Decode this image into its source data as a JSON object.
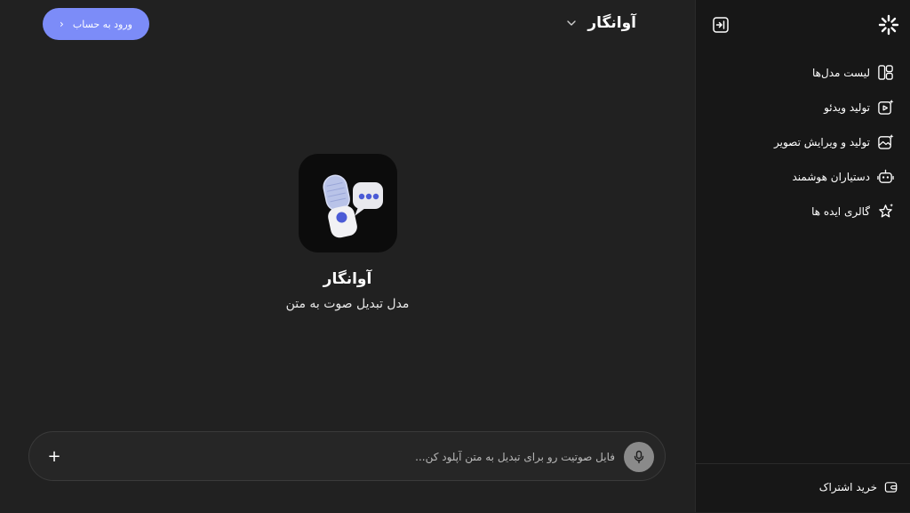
{
  "header": {
    "login_label": "ورود به حساب",
    "model_name": "آوانگار"
  },
  "hero": {
    "title": "آوانگار",
    "subtitle": "مدل تبدیل صوت به متن"
  },
  "composer": {
    "placeholder": "فایل صوتیت رو برای تبدیل به متن آپلود کن...",
    "value": "",
    "plus_label": "+"
  },
  "sidebar": {
    "items": [
      {
        "label": "لیست مدل‌ها",
        "icon": "layout-grid-icon"
      },
      {
        "label": "تولید ویدئو",
        "icon": "video-sparkle-icon"
      },
      {
        "label": "تولید و ویرایش تصویر",
        "icon": "image-sparkle-icon"
      },
      {
        "label": "دستیاران هوشمند",
        "icon": "robot-icon"
      },
      {
        "label": "گالری ایده ها",
        "icon": "star-sparkle-icon"
      }
    ],
    "footer": {
      "buy_label": "خرید اشتراک",
      "icon": "wallet-icon"
    }
  },
  "colors": {
    "background": "#212121",
    "sidebar": "#171717",
    "accent": "#7c8cf8",
    "mic_button": "#8a8a8a"
  }
}
